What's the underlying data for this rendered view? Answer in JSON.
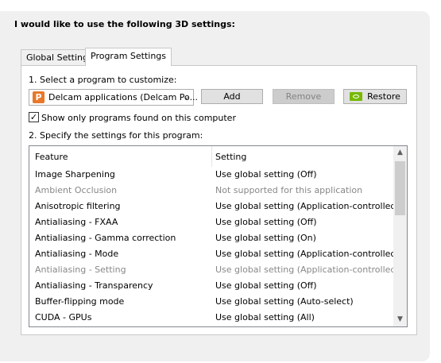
{
  "heading": "I would like to use the following 3D settings:",
  "tabs": [
    {
      "label": "Global Settings",
      "active": false
    },
    {
      "label": "Program Settings",
      "active": true
    }
  ],
  "step1": {
    "label": "1. Select a program to customize:",
    "program_select": {
      "value": "Delcam applications (Delcam Po..."
    },
    "buttons": {
      "add": "Add",
      "remove": "Remove",
      "restore": "Restore"
    }
  },
  "filter_checkbox": {
    "label": "Show only programs found on this computer",
    "checked": true
  },
  "step2": {
    "label": "2. Specify the settings for this program:",
    "columns": {
      "feature": "Feature",
      "setting": "Setting"
    },
    "rows": [
      {
        "feature": "Image Sharpening",
        "setting": "Use global setting (Off)",
        "disabled": false
      },
      {
        "feature": "Ambient Occlusion",
        "setting": "Not supported for this application",
        "disabled": true
      },
      {
        "feature": "Anisotropic filtering",
        "setting": "Use global setting (Application-controlled)",
        "disabled": false
      },
      {
        "feature": "Antialiasing - FXAA",
        "setting": "Use global setting (Off)",
        "disabled": false
      },
      {
        "feature": "Antialiasing - Gamma correction",
        "setting": "Use global setting (On)",
        "disabled": false
      },
      {
        "feature": "Antialiasing - Mode",
        "setting": "Use global setting (Application-controlled)",
        "disabled": false
      },
      {
        "feature": "Antialiasing - Setting",
        "setting": "Use global setting (Application-controlled)",
        "disabled": true
      },
      {
        "feature": "Antialiasing - Transparency",
        "setting": "Use global setting (Off)",
        "disabled": false
      },
      {
        "feature": "Buffer-flipping mode",
        "setting": "Use global setting (Auto-select)",
        "disabled": false
      },
      {
        "feature": "CUDA - GPUs",
        "setting": "Use global setting (All)",
        "disabled": false
      }
    ]
  },
  "colors": {
    "accent_nvidia": "#76b900",
    "app_icon": "#e8782a",
    "disabled_text": "#888888"
  },
  "icons": {
    "app_icon": "delcam-powermill-icon",
    "restore_icon": "nvidia-logo-icon"
  }
}
